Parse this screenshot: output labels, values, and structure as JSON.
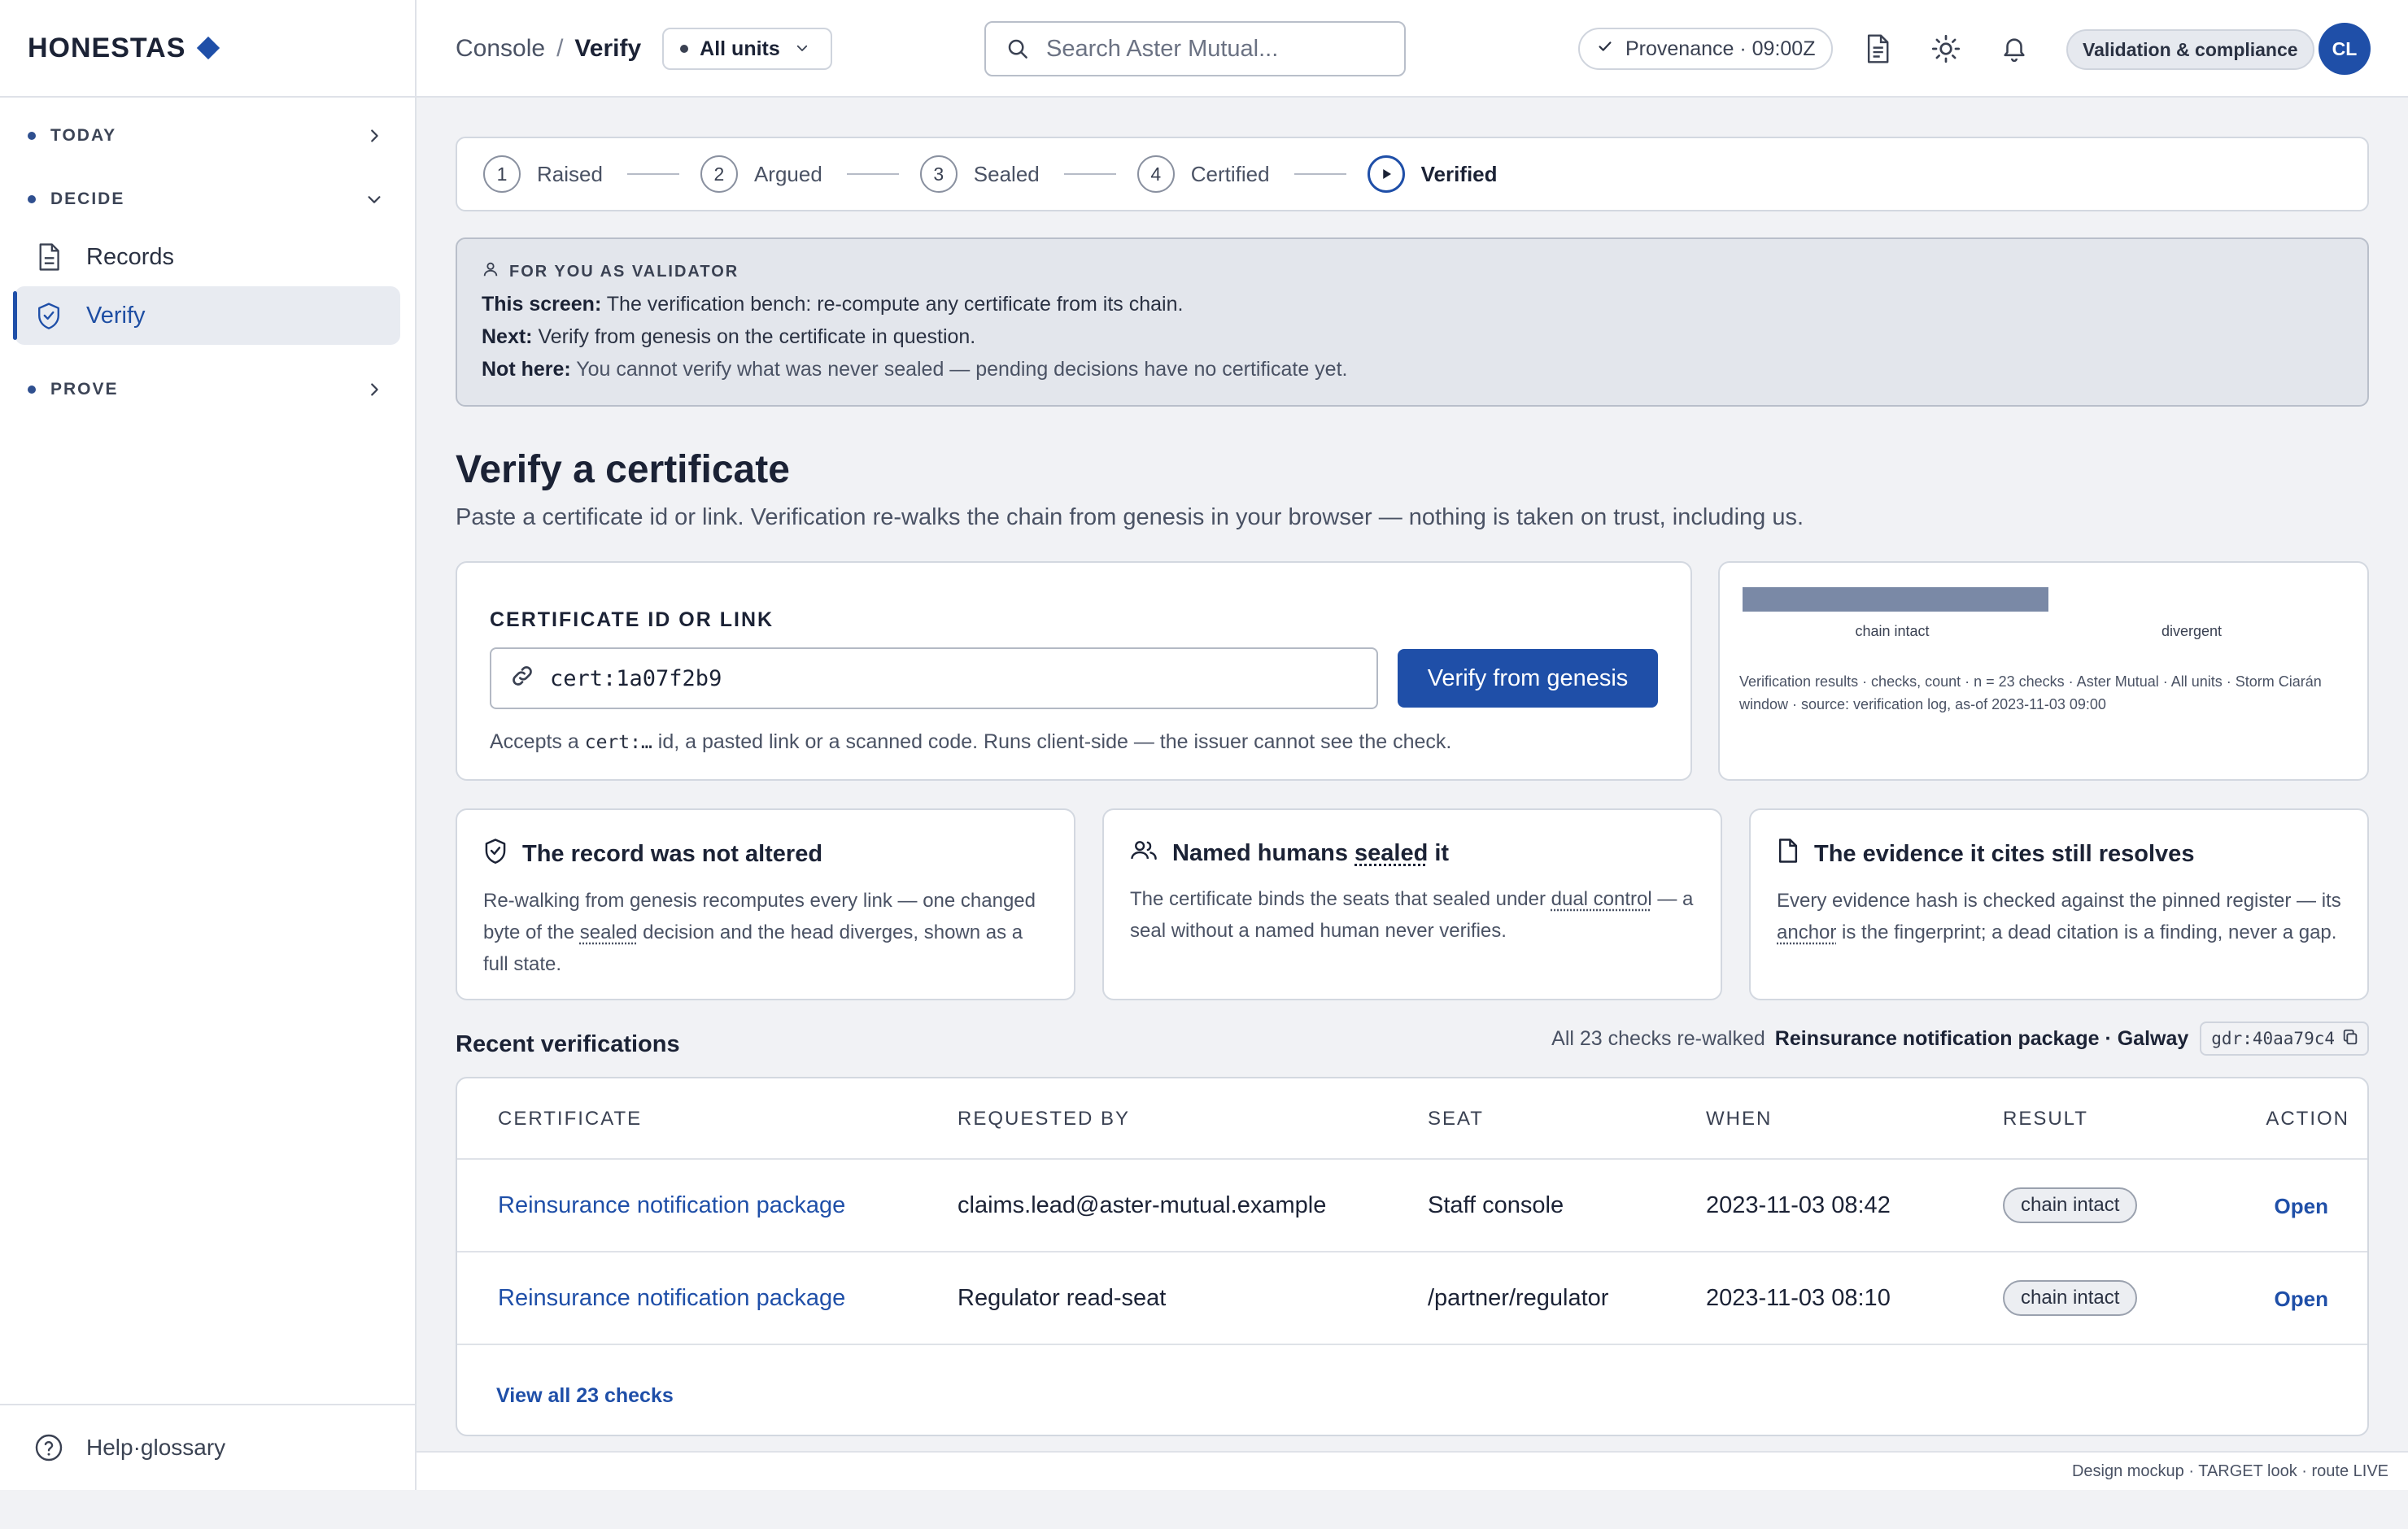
{
  "brand": {
    "name": "HONESTAS"
  },
  "sidebar": {
    "sections": [
      {
        "label": "TODAY",
        "expanded": false
      },
      {
        "label": "DECIDE",
        "expanded": true
      },
      {
        "label": "PROVE",
        "expanded": false
      }
    ],
    "items": [
      {
        "label": "Records",
        "icon": "document-icon",
        "active": false
      },
      {
        "label": "Verify",
        "icon": "shield-check-icon",
        "active": true
      }
    ],
    "help_label": "Help·glossary"
  },
  "topbar": {
    "crumb_root": "Console",
    "crumb_sep": "/",
    "crumb_current": "Verify",
    "units_label": "All units",
    "search_placeholder": "Search Aster Mutual...",
    "provenance": "Provenance · 09:00Z",
    "role": "Validation & compliance",
    "avatar_initials": "CL"
  },
  "stepper": {
    "steps": [
      {
        "num": "1",
        "label": "Raised"
      },
      {
        "num": "2",
        "label": "Argued"
      },
      {
        "num": "3",
        "label": "Sealed"
      },
      {
        "num": "4",
        "label": "Certified"
      },
      {
        "num": "",
        "label": "Verified",
        "active": true
      }
    ]
  },
  "notice": {
    "heading": "FOR YOU AS VALIDATOR",
    "this_screen_label": "This screen:",
    "this_screen": "The verification bench: re-compute any certificate from its chain.",
    "next_label": "Next:",
    "next": "Verify from genesis on the certificate in question.",
    "not_here_label": "Not here:",
    "not_here": "You cannot verify what was never sealed — pending decisions have no certificate yet."
  },
  "page": {
    "title": "Verify a certificate",
    "subtitle": "Paste a certificate id or link. Verification re-walks the chain from genesis in your browser — nothing is taken on trust, including us."
  },
  "cert_form": {
    "label": "CERTIFICATE ID OR LINK",
    "value": "cert:1a07f2b9",
    "button": "Verify from genesis",
    "hint_pre": "Accepts a",
    "hint_code": "cert:…",
    "hint_post": "id, a pasted link or a scanned code. Runs client-side — the issuer cannot see the check."
  },
  "chart_data": {
    "type": "bar",
    "categories": [
      "chain intact",
      "divergent"
    ],
    "values": [
      23,
      0
    ],
    "caption": "Verification results · checks, count · n = 23 checks · Aster Mutual · All units · Storm Ciarán window · source: verification log, as-of 2023-11-03 09:00",
    "colors": {
      "bar": "#7a89a6"
    }
  },
  "features": [
    {
      "icon": "shield-check-icon",
      "title": "The record was not altered",
      "desc_a": "Re-walking from genesis recomputes every link — one changed byte of the ",
      "desc_term": "sealed",
      "desc_b": " decision and the head diverges, shown as a full state."
    },
    {
      "icon": "users-icon",
      "title_a": "Named humans ",
      "title_term": "sealed",
      "title_b": " it",
      "desc_a": "The certificate binds the seats that sealed under ",
      "desc_term": "dual control",
      "desc_b": " — a seal without a named human never verifies."
    },
    {
      "icon": "file-icon",
      "title": "The evidence it cites still resolves",
      "desc_a": "Every evidence hash is checked against the pinned register — its ",
      "desc_term": "anchor",
      "desc_b": " is the fingerprint; a dead citation is a finding, never a gap."
    }
  ],
  "recent": {
    "title": "Recent verifications",
    "meta": "All 23 checks re-walked",
    "meta_strong": "Reinsurance notification package · Galway",
    "hash": "gdr:40aa79c4",
    "columns": [
      "CERTIFICATE",
      "REQUESTED BY",
      "SEAT",
      "WHEN",
      "RESULT",
      "ACTION"
    ],
    "rows": [
      {
        "certificate": "Reinsurance notification package",
        "requested_by": "claims.lead@aster-mutual.example",
        "seat": "Staff console",
        "when": "2023-11-03 08:42",
        "result": "chain intact",
        "action": "Open"
      },
      {
        "certificate": "Reinsurance notification package",
        "requested_by": "Regulator read-seat",
        "seat": "/partner/regulator",
        "when": "2023-11-03 08:10",
        "result": "chain intact",
        "action": "Open"
      }
    ],
    "view_all": "View all 23 checks"
  },
  "footer": {
    "text": "Design mockup · TARGET look · route LIVE"
  },
  "colors": {
    "accent": "#1f4fa8",
    "background": "#f1f2f5"
  }
}
